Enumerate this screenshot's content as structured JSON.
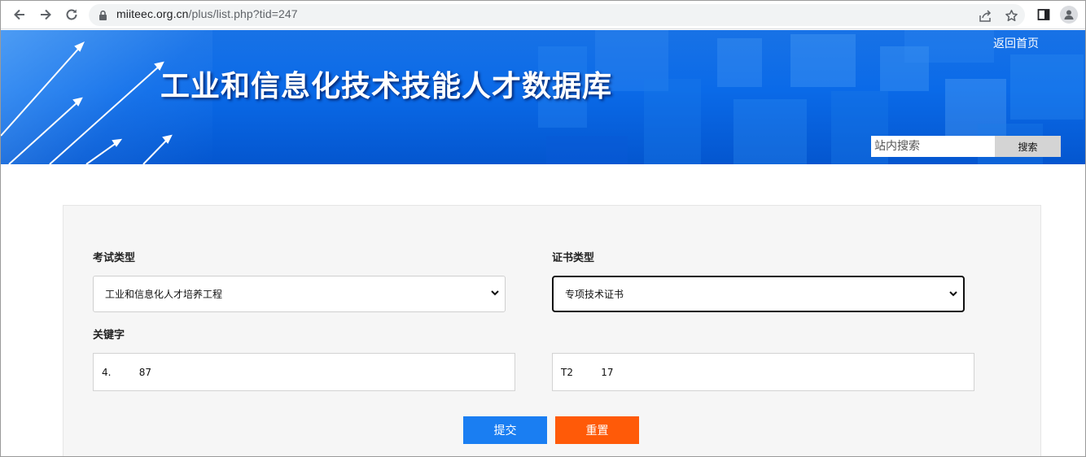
{
  "browser": {
    "url_host": "miiteec.org.cn",
    "url_path": "/plus/list.php?tid=247"
  },
  "header": {
    "title": "工业和信息化技术技能人才数据库",
    "home_link": "返回首页",
    "search_placeholder": "站内搜索",
    "search_button": "搜索"
  },
  "form": {
    "exam_type_label": "考试类型",
    "exam_type_value": "工业和信息化人才培养工程",
    "cert_type_label": "证书类型",
    "cert_type_value": "专项技术证书",
    "keyword_label": "关键字",
    "keyword_1_value": "4.         87",
    "keyword_2_value": "T2         17",
    "submit_label": "提交",
    "reset_label": "重置"
  }
}
